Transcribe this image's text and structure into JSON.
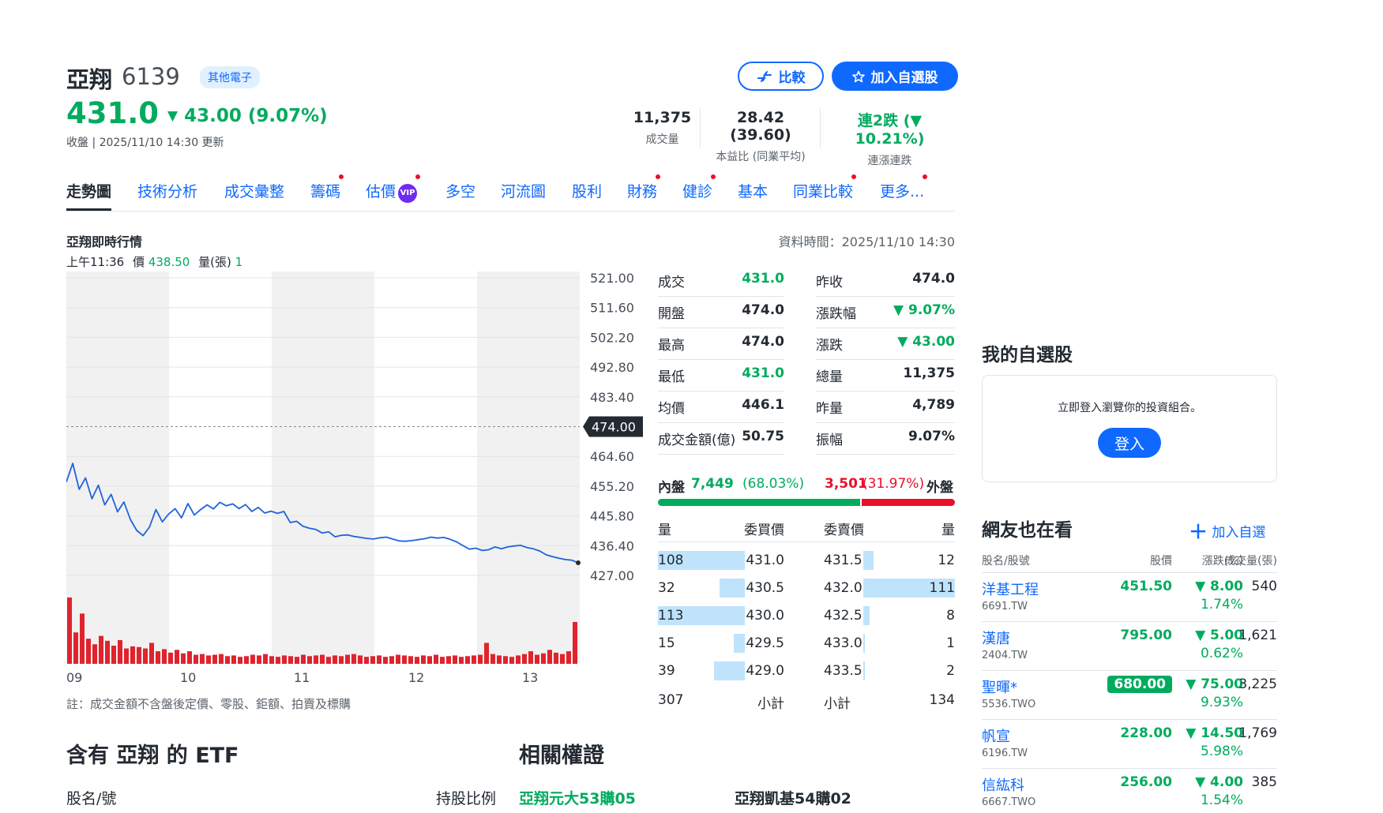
{
  "header": {
    "name": "亞翔",
    "code": "6139",
    "sector": "其他電子",
    "price": "431.0",
    "change": "43.00 (9.07%)",
    "close_time": "收盤 | 2025/11/10 14:30 更新",
    "compare_label": "比較",
    "watch_label": "加入自選股",
    "stats": [
      {
        "value": "11,375",
        "label": "成交量"
      },
      {
        "value": "28.42 (39.60)",
        "label": "本益比 (同業平均)"
      },
      {
        "value": "連2跌 (▼ 10.21%)",
        "label": "連漲連跌"
      }
    ]
  },
  "tabs": [
    {
      "label": "走勢圖",
      "active": true
    },
    {
      "label": "技術分析"
    },
    {
      "label": "成交彙整"
    },
    {
      "label": "籌碼",
      "dot": true
    },
    {
      "label": "估價",
      "dot": true,
      "vip": "VIP"
    },
    {
      "label": "多空"
    },
    {
      "label": "河流圖"
    },
    {
      "label": "股利"
    },
    {
      "label": "財務",
      "dot": true
    },
    {
      "label": "健診",
      "dot": true
    },
    {
      "label": "基本"
    },
    {
      "label": "同業比較",
      "dot": true
    },
    {
      "label": "更多...",
      "dot": true
    }
  ],
  "chart_section": {
    "title": "亞翔即時行情",
    "data_time": "資料時間：2025/11/10 14:30",
    "hover_time": "上午11:36",
    "hover_price_label": "價",
    "hover_price": "438.50",
    "hover_vol_label": "量(張)",
    "hover_vol": "1",
    "note": "註：成交金額不含盤後定價、零股、鉅額、拍賣及標購"
  },
  "chart_data": {
    "type": "line",
    "y_ticks": [
      "521.00",
      "511.60",
      "502.20",
      "492.80",
      "483.40",
      "464.60",
      "455.20",
      "445.80",
      "436.40",
      "427.00"
    ],
    "ylim": [
      427.0,
      521.0
    ],
    "reference_price": "474.00",
    "x_labels": [
      "09",
      "10",
      "11",
      "12",
      "13"
    ],
    "series": [
      {
        "values": [
          456.5,
          462.4,
          454.2,
          457.8,
          451.2,
          455.5,
          449.3,
          452.6,
          447.1,
          450.2,
          444.7,
          441.2,
          439.6,
          442.3,
          447.8,
          443.9,
          446.4,
          448.1,
          445.2,
          449.7,
          446.1,
          447.8,
          449.3,
          448.0,
          450.1,
          449.0,
          449.6,
          448.1,
          449.4,
          447.2,
          448.5,
          446.7,
          447.3,
          446.6,
          447.2,
          443.7,
          444.1,
          442.5,
          441.9,
          441.5,
          440.4,
          440.8,
          439.2,
          439.7,
          439.8,
          439.3,
          439.0,
          438.7,
          438.5,
          438.9,
          439.1,
          438.5,
          437.9,
          437.8,
          438.0,
          438.3,
          438.6,
          439.1,
          438.8,
          439.0,
          438.4,
          437.6,
          436.4,
          435.3,
          435.6,
          434.9,
          435.1,
          436.0,
          435.4,
          436.0,
          436.3,
          436.5,
          435.8,
          435.4,
          434.7,
          433.5,
          432.9,
          432.4,
          432.0,
          431.8,
          431.0
        ]
      }
    ],
    "volume": [
      95,
      45,
      72,
      36,
      28,
      40,
      33,
      26,
      34,
      22,
      25,
      24,
      22,
      30,
      18,
      21,
      16,
      20,
      15,
      18,
      13,
      14,
      12,
      13,
      14,
      11,
      12,
      10,
      11,
      13,
      12,
      14,
      11,
      10,
      12,
      11,
      10,
      13,
      11,
      12,
      13,
      10,
      12,
      11,
      13,
      14,
      12,
      10,
      11,
      12,
      10,
      11,
      13,
      12,
      11,
      10,
      12,
      11,
      13,
      10,
      11,
      12,
      10,
      11,
      12,
      13,
      30,
      14,
      12,
      11,
      10,
      12,
      14,
      18,
      13,
      15,
      20,
      16,
      14,
      18,
      60
    ],
    "ref_color": "#232a31",
    "line_color": "#1e64dc",
    "volume_color": "#e0232d"
  },
  "quotes": {
    "left": [
      {
        "label": "成交",
        "value": "431.0",
        "color": "green"
      },
      {
        "label": "開盤",
        "value": "474.0"
      },
      {
        "label": "最高",
        "value": "474.0"
      },
      {
        "label": "最低",
        "value": "431.0",
        "color": "green"
      },
      {
        "label": "均價",
        "value": "446.1"
      },
      {
        "label": "成交金額(億)",
        "value": "50.75"
      }
    ],
    "right": [
      {
        "label": "昨收",
        "value": "474.0"
      },
      {
        "label": "漲跌幅",
        "value": "▼ 9.07%",
        "color": "green"
      },
      {
        "label": "漲跌",
        "value": "▼ 43.00",
        "color": "green"
      },
      {
        "label": "總量",
        "value": "11,375"
      },
      {
        "label": "昨量",
        "value": "4,789"
      },
      {
        "label": "振幅",
        "value": "9.07%"
      }
    ]
  },
  "order_book": {
    "inner_label": "內盤",
    "inner_value": "7,449",
    "inner_pct": "(68.03%)",
    "outer_value": "3,501",
    "outer_pct": "(31.97%)",
    "outer_label": "外盤",
    "inner_ratio": 0.6803,
    "headers": [
      "量",
      "委買價",
      "委賣價",
      "量"
    ],
    "bids": [
      {
        "qty": "108",
        "price": "431.0",
        "ratio": 1.0
      },
      {
        "qty": "32",
        "price": "430.5",
        "ratio": 0.29
      },
      {
        "qty": "113",
        "price": "430.0",
        "ratio": 1.0
      },
      {
        "qty": "15",
        "price": "429.5",
        "ratio": 0.13
      },
      {
        "qty": "39",
        "price": "429.0",
        "ratio": 0.35
      }
    ],
    "asks": [
      {
        "price": "431.5",
        "qty": "12",
        "ratio": 0.11
      },
      {
        "price": "432.0",
        "qty": "111",
        "ratio": 1.0
      },
      {
        "price": "432.5",
        "qty": "8",
        "ratio": 0.07
      },
      {
        "price": "433.0",
        "qty": "1",
        "ratio": 0.01
      },
      {
        "price": "433.5",
        "qty": "2",
        "ratio": 0.02
      }
    ],
    "bid_total": "307",
    "bid_total_label": "小計",
    "ask_total_label": "小計",
    "ask_total": "134"
  },
  "bottom": {
    "etf_title": "含有 亞翔 的 ETF",
    "warrant_title": "相關權證",
    "etf_col_name": "股名/號",
    "etf_col_ratio": "持股比例",
    "warrant_1": "亞翔元大53購05",
    "warrant_2": "亞翔凱基54購02"
  },
  "sidebar": {
    "watch_title": "我的自選股",
    "login_msg": "立即登入瀏覽你的投資組合。",
    "login_label": "登入",
    "peers_title": "網友也在看",
    "peers_add": "加入自選",
    "headers": [
      "股名/股號",
      "股價",
      "漲跌(%)",
      "成交量(張)"
    ],
    "peers": [
      {
        "name": "洋基工程",
        "code": "6691.TW",
        "price": "451.50",
        "change": "▼ 8.00",
        "pct": "1.74%",
        "volume": "540"
      },
      {
        "name": "漢唐",
        "code": "2404.TW",
        "price": "795.00",
        "change": "▼ 5.00",
        "pct": "0.62%",
        "volume": "1,621"
      },
      {
        "name": "聖暉*",
        "code": "5536.TWO",
        "price": "680.00",
        "change": "▼ 75.00",
        "pct": "9.93%",
        "volume": "3,225",
        "highlight": true
      },
      {
        "name": "帆宣",
        "code": "6196.TW",
        "price": "228.00",
        "change": "▼ 14.50",
        "pct": "5.98%",
        "volume": "1,769"
      },
      {
        "name": "信紘科",
        "code": "6667.TWO",
        "price": "256.00",
        "change": "▼ 4.00",
        "pct": "1.54%",
        "volume": "385"
      }
    ]
  }
}
